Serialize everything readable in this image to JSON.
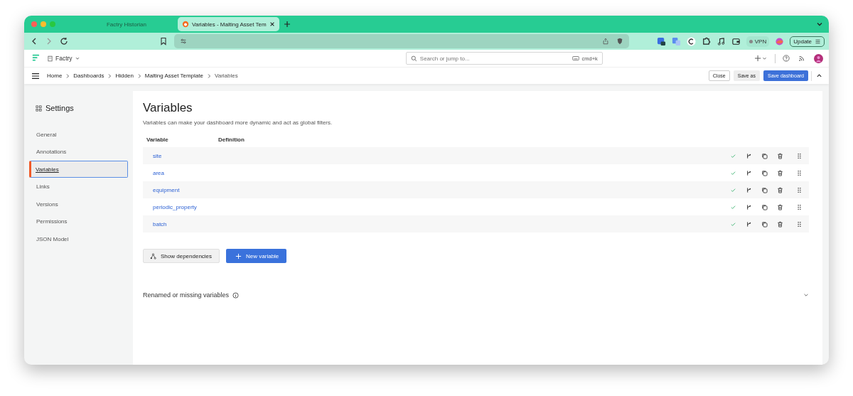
{
  "browser": {
    "tabs": [
      {
        "title": "Factry Historian",
        "selected": false
      },
      {
        "title": "Variables - Malting Asset Tem",
        "selected": true
      }
    ],
    "vpn": "VPN",
    "update": "Update"
  },
  "header": {
    "org": "Factry",
    "search": {
      "placeholder": "Search or jump to...",
      "shortcut": "cmd+k"
    }
  },
  "breadcrumbs": [
    "Home",
    "Dashboards",
    "Hidden",
    "Malting Asset Template",
    "Variables"
  ],
  "actions": [
    {
      "label": "Close",
      "kind": "outline"
    },
    {
      "label": "Save as",
      "kind": "secondary"
    },
    {
      "label": "Save dashboard",
      "kind": "primary"
    }
  ],
  "sidebar": {
    "title": "Settings",
    "items": [
      {
        "label": "General",
        "selected": false
      },
      {
        "label": "Annotations",
        "selected": false
      },
      {
        "label": "Variables",
        "selected": true
      },
      {
        "label": "Links",
        "selected": false
      },
      {
        "label": "Versions",
        "selected": false
      },
      {
        "label": "Permissions",
        "selected": false
      },
      {
        "label": "JSON Model",
        "selected": false
      }
    ]
  },
  "page": {
    "title": "Variables",
    "description": "Variables can make your dashboard more dynamic and act as global filters.",
    "columns": [
      "Variable",
      "Definition"
    ],
    "rows": [
      {
        "name": "site",
        "valid": true
      },
      {
        "name": "area",
        "valid": true
      },
      {
        "name": "equipment",
        "valid": true
      },
      {
        "name": "periodic_property",
        "valid": true
      },
      {
        "name": "batch",
        "valid": true
      }
    ],
    "buttons": [
      {
        "label": "Show dependencies",
        "kind": "secondary"
      },
      {
        "label": "New variable",
        "kind": "primary"
      }
    ],
    "missing_section": {
      "title": "Renamed or missing variables",
      "expanded": false
    }
  }
}
